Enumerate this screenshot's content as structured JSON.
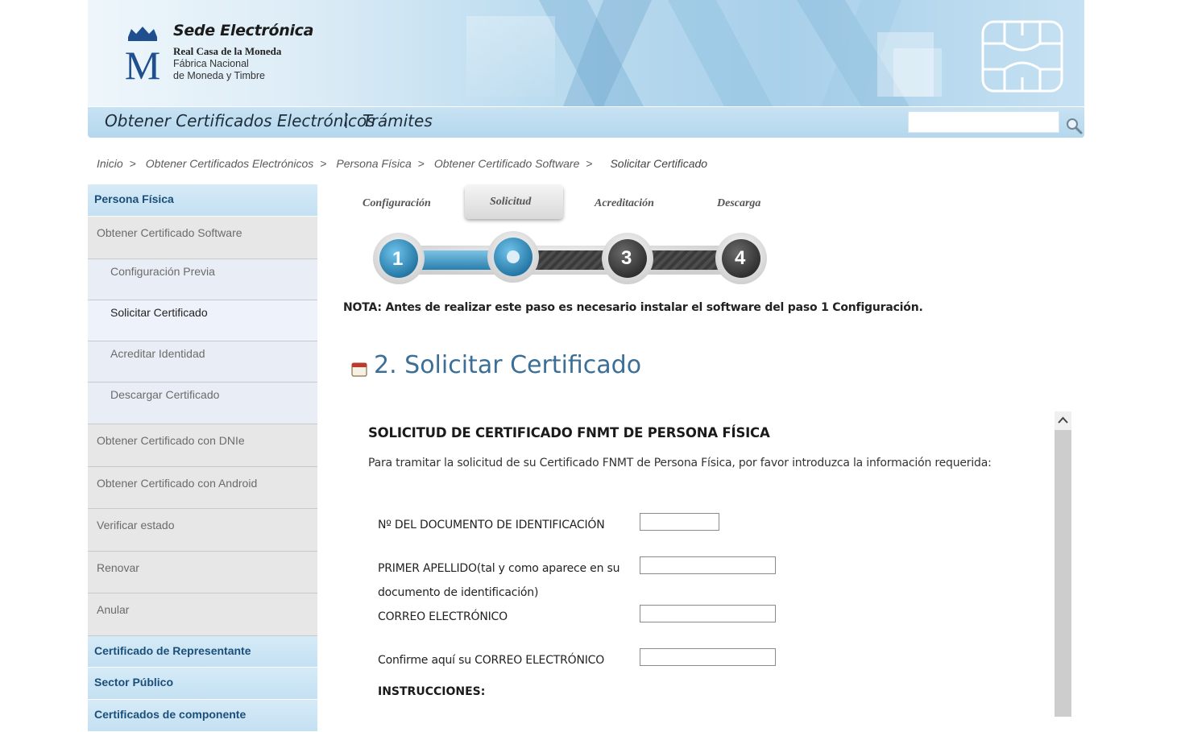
{
  "header": {
    "brand_title": "Sede Electrónica",
    "brand_sub1": "Real Casa de la Moneda",
    "brand_sub2_line1": "Fábrica Nacional",
    "brand_sub2_line2": "de Moneda y Timbre",
    "nav": {
      "certs": "Obtener Certificados Electrónicos",
      "sep": "|",
      "tramites": "Trámites"
    },
    "search": {
      "value": "",
      "placeholder": ""
    }
  },
  "breadcrumb": {
    "items": [
      "Inicio",
      "Obtener Certificados Electrónicos",
      "Persona Física",
      "Obtener Certificado Software"
    ],
    "separator": ">",
    "current": "Solicitar Certificado"
  },
  "sidebar": {
    "header1": "Persona Física",
    "items": [
      "Obtener Certificado Software",
      "Configuración Previa",
      "Solicitar Certificado",
      "Acreditar Identidad",
      "Descargar Certificado",
      "Obtener Certificado con DNIe",
      "Obtener Certificado con Android",
      "Verificar estado",
      "Renovar",
      "Anular"
    ],
    "header2": "Certificado de Representante",
    "header3": "Sector Público",
    "header4": "Certificados de componente"
  },
  "steps": {
    "labels": [
      "Configuración",
      "Solicitud",
      "Acreditación",
      "Descarga"
    ],
    "numbers": [
      "1",
      "3",
      "4"
    ],
    "current_step": 2
  },
  "note": "NOTA: Antes de realizar este paso es necesario instalar el software del paso 1 Configuración.",
  "section_title": "2. Solicitar Certificado",
  "form": {
    "title": "SOLICITUD DE CERTIFICADO FNMT DE PERSONA FÍSICA",
    "intro": "Para tramitar la solicitud de su Certificado FNMT de Persona Física, por favor introduzca la información requerida:",
    "doc_label": "Nº DEL DOCUMENTO DE IDENTIFICACIÓN",
    "apellido_label1": "PRIMER APELLIDO(tal y como aparece en su",
    "apellido_label2": "documento de identificación)",
    "email_label": "CORREO ELECTRÓNICO",
    "email_confirm_label": "Confirme aquí su CORREO ELECTRÓNICO",
    "instructions": "INSTRUCCIONES:",
    "doc_value": "",
    "apellido_value": "",
    "email_value": "",
    "email_confirm_value": ""
  },
  "colors": {
    "title_blue": "#3b6f97",
    "sidebar_header": "#1b4f7a",
    "step_active": "#3a9cc8"
  },
  "icons": [
    "fnmt-crown-logo",
    "smart-chip-icon",
    "search-icon",
    "calendar-icon",
    "scroll-up-arrow-icon"
  ]
}
